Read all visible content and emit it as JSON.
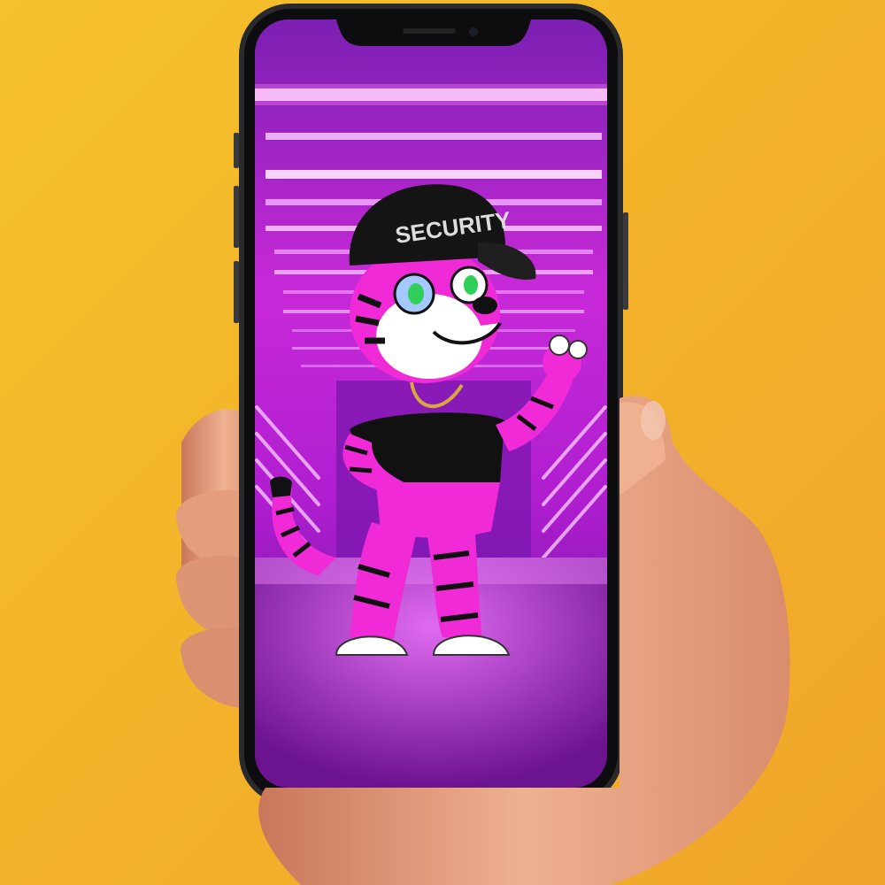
{
  "scene": {
    "background_color": "#f2b827",
    "phone_frame_color": "#1c1c1e",
    "screen_glow_color": "#c21fd6",
    "neon_color": "#ff8af5",
    "floor_color": "#9a1fc6"
  },
  "character": {
    "kind": "pink tiger mascot",
    "cap_text": "SECURITY",
    "fur_color": "#f02ad6",
    "stripe_color": "#111111",
    "shirt_color": "#111111",
    "eye_color": "#2fcf5a"
  },
  "hand": {
    "skin_color": "#e9a27e"
  },
  "icons": [
    "phone-notch-icon",
    "camera-icon"
  ]
}
